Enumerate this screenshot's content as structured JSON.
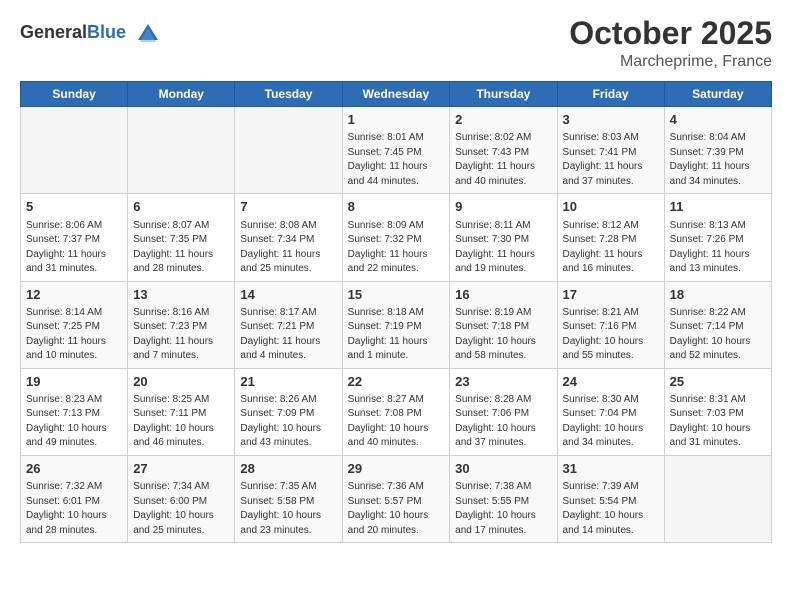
{
  "header": {
    "logo_general": "General",
    "logo_blue": "Blue",
    "title": "October 2025",
    "subtitle": "Marcheprime, France"
  },
  "weekdays": [
    "Sunday",
    "Monday",
    "Tuesday",
    "Wednesday",
    "Thursday",
    "Friday",
    "Saturday"
  ],
  "weeks": [
    [
      {
        "day": "",
        "info": ""
      },
      {
        "day": "",
        "info": ""
      },
      {
        "day": "",
        "info": ""
      },
      {
        "day": "1",
        "info": "Sunrise: 8:01 AM\nSunset: 7:45 PM\nDaylight: 11 hours\nand 44 minutes."
      },
      {
        "day": "2",
        "info": "Sunrise: 8:02 AM\nSunset: 7:43 PM\nDaylight: 11 hours\nand 40 minutes."
      },
      {
        "day": "3",
        "info": "Sunrise: 8:03 AM\nSunset: 7:41 PM\nDaylight: 11 hours\nand 37 minutes."
      },
      {
        "day": "4",
        "info": "Sunrise: 8:04 AM\nSunset: 7:39 PM\nDaylight: 11 hours\nand 34 minutes."
      }
    ],
    [
      {
        "day": "5",
        "info": "Sunrise: 8:06 AM\nSunset: 7:37 PM\nDaylight: 11 hours\nand 31 minutes."
      },
      {
        "day": "6",
        "info": "Sunrise: 8:07 AM\nSunset: 7:35 PM\nDaylight: 11 hours\nand 28 minutes."
      },
      {
        "day": "7",
        "info": "Sunrise: 8:08 AM\nSunset: 7:34 PM\nDaylight: 11 hours\nand 25 minutes."
      },
      {
        "day": "8",
        "info": "Sunrise: 8:09 AM\nSunset: 7:32 PM\nDaylight: 11 hours\nand 22 minutes."
      },
      {
        "day": "9",
        "info": "Sunrise: 8:11 AM\nSunset: 7:30 PM\nDaylight: 11 hours\nand 19 minutes."
      },
      {
        "day": "10",
        "info": "Sunrise: 8:12 AM\nSunset: 7:28 PM\nDaylight: 11 hours\nand 16 minutes."
      },
      {
        "day": "11",
        "info": "Sunrise: 8:13 AM\nSunset: 7:26 PM\nDaylight: 11 hours\nand 13 minutes."
      }
    ],
    [
      {
        "day": "12",
        "info": "Sunrise: 8:14 AM\nSunset: 7:25 PM\nDaylight: 11 hours\nand 10 minutes."
      },
      {
        "day": "13",
        "info": "Sunrise: 8:16 AM\nSunset: 7:23 PM\nDaylight: 11 hours\nand 7 minutes."
      },
      {
        "day": "14",
        "info": "Sunrise: 8:17 AM\nSunset: 7:21 PM\nDaylight: 11 hours\nand 4 minutes."
      },
      {
        "day": "15",
        "info": "Sunrise: 8:18 AM\nSunset: 7:19 PM\nDaylight: 11 hours\nand 1 minute."
      },
      {
        "day": "16",
        "info": "Sunrise: 8:19 AM\nSunset: 7:18 PM\nDaylight: 10 hours\nand 58 minutes."
      },
      {
        "day": "17",
        "info": "Sunrise: 8:21 AM\nSunset: 7:16 PM\nDaylight: 10 hours\nand 55 minutes."
      },
      {
        "day": "18",
        "info": "Sunrise: 8:22 AM\nSunset: 7:14 PM\nDaylight: 10 hours\nand 52 minutes."
      }
    ],
    [
      {
        "day": "19",
        "info": "Sunrise: 8:23 AM\nSunset: 7:13 PM\nDaylight: 10 hours\nand 49 minutes."
      },
      {
        "day": "20",
        "info": "Sunrise: 8:25 AM\nSunset: 7:11 PM\nDaylight: 10 hours\nand 46 minutes."
      },
      {
        "day": "21",
        "info": "Sunrise: 8:26 AM\nSunset: 7:09 PM\nDaylight: 10 hours\nand 43 minutes."
      },
      {
        "day": "22",
        "info": "Sunrise: 8:27 AM\nSunset: 7:08 PM\nDaylight: 10 hours\nand 40 minutes."
      },
      {
        "day": "23",
        "info": "Sunrise: 8:28 AM\nSunset: 7:06 PM\nDaylight: 10 hours\nand 37 minutes."
      },
      {
        "day": "24",
        "info": "Sunrise: 8:30 AM\nSunset: 7:04 PM\nDaylight: 10 hours\nand 34 minutes."
      },
      {
        "day": "25",
        "info": "Sunrise: 8:31 AM\nSunset: 7:03 PM\nDaylight: 10 hours\nand 31 minutes."
      }
    ],
    [
      {
        "day": "26",
        "info": "Sunrise: 7:32 AM\nSunset: 6:01 PM\nDaylight: 10 hours\nand 28 minutes."
      },
      {
        "day": "27",
        "info": "Sunrise: 7:34 AM\nSunset: 6:00 PM\nDaylight: 10 hours\nand 25 minutes."
      },
      {
        "day": "28",
        "info": "Sunrise: 7:35 AM\nSunset: 5:58 PM\nDaylight: 10 hours\nand 23 minutes."
      },
      {
        "day": "29",
        "info": "Sunrise: 7:36 AM\nSunset: 5:57 PM\nDaylight: 10 hours\nand 20 minutes."
      },
      {
        "day": "30",
        "info": "Sunrise: 7:38 AM\nSunset: 5:55 PM\nDaylight: 10 hours\nand 17 minutes."
      },
      {
        "day": "31",
        "info": "Sunrise: 7:39 AM\nSunset: 5:54 PM\nDaylight: 10 hours\nand 14 minutes."
      },
      {
        "day": "",
        "info": ""
      }
    ]
  ]
}
